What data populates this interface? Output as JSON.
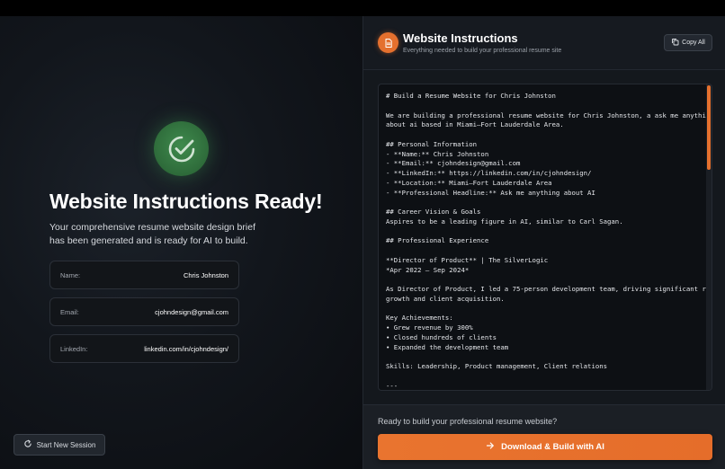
{
  "left_panel": {
    "title": "Website Instructions Ready!",
    "subtitle": "Your comprehensive resume website design brief has been generated and is ready for AI to build.",
    "fields": [
      {
        "label": "Name:",
        "value": "Chris Johnston"
      },
      {
        "label": "Email:",
        "value": "cjohndesign@gmail.com"
      },
      {
        "label": "LinkedIn:",
        "value": "linkedin.com/in/cjohndesign/"
      }
    ],
    "start_session_label": "Start New Session"
  },
  "right_panel": {
    "title": "Website Instructions",
    "subtitle": "Everything needed to build your professional resume site",
    "copy_label": "Copy All",
    "instructions": "# Build a Resume Website for Chris Johnston\n\nWe are building a professional resume website for Chris Johnston, a ask me anything\nabout ai based in Miami–Fort Lauderdale Area.\n\n## Personal Information\n- **Name:** Chris Johnston\n- **Email:** cjohndesign@gmail.com\n- **LinkedIn:** https://linkedin.com/in/cjohndesign/\n- **Location:** Miami–Fort Lauderdale Area\n- **Professional Headline:** Ask me anything about AI\n\n## Career Vision & Goals\nAspires to be a leading figure in AI, similar to Carl Sagan.\n\n## Professional Experience\n\n**Director of Product** | The SilverLogic\n*Apr 2022 – Sep 2024*\n\nAs Director of Product, I led a 75-person development team, driving significant revenue\ngrowth and client acquisition.\n\nKey Achievements:\n• Grew revenue by 300%\n• Closed hundreds of clients\n• Expanded the development team\n\nSkills: Leadership, Product management, Client relations\n\n---",
    "ready_prompt": "Ready to build your professional resume website?",
    "build_label": "Download & Build with AI"
  },
  "icons": {
    "status": "check-circle-icon",
    "doc": "document-icon",
    "copy": "copy-icon",
    "refresh": "refresh-icon",
    "arrow": "arrow-right-icon"
  },
  "colors": {
    "accent": "#e9742f",
    "success": "#3f8a4d",
    "panel": "#14181d"
  }
}
